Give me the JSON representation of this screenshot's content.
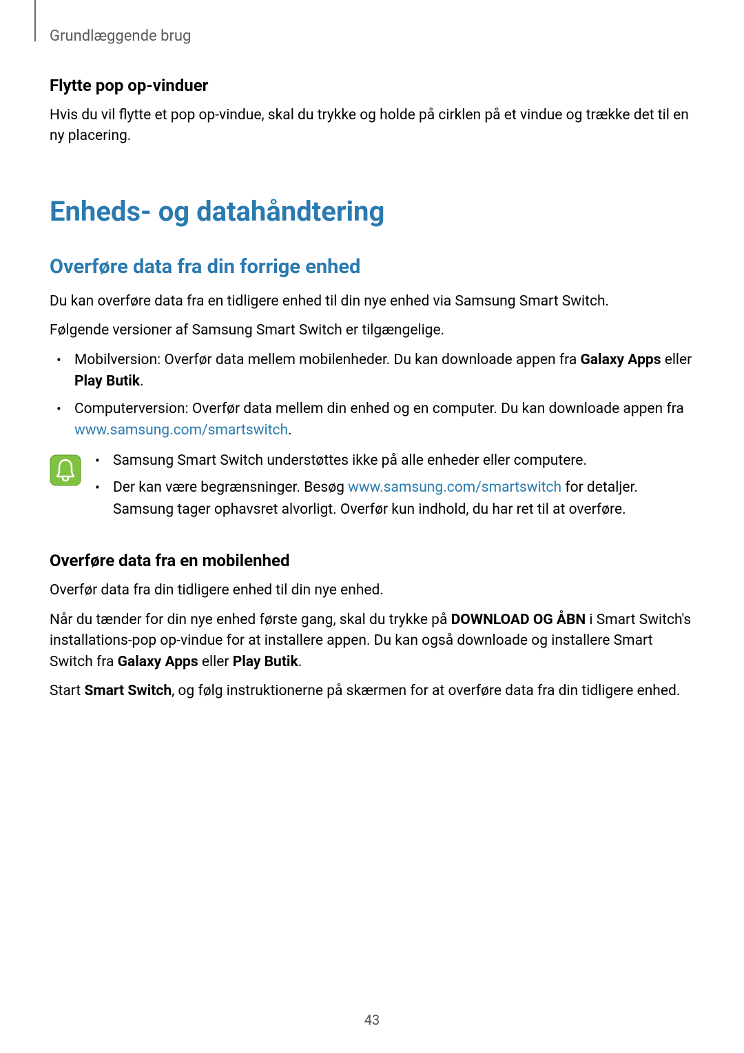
{
  "header": {
    "breadcrumb": "Grundlæggende brug"
  },
  "section1": {
    "title": "Flytte pop op-vinduer",
    "body": "Hvis du vil flytte et pop op-vindue, skal du trykke og holde på cirklen på et vindue og trække det til en ny placering."
  },
  "mainHeading": "Enheds- og datahåndtering",
  "section2": {
    "title": "Overføre data fra din forrige enhed",
    "body1": "Du kan overføre data fra en tidligere enhed til din nye enhed via Samsung Smart Switch.",
    "body2": "Følgende versioner af Samsung Smart Switch er tilgængelige.",
    "bullets": {
      "b1_pre": "Mobilversion: Overfør data mellem mobilenheder. Du kan downloade appen fra ",
      "b1_bold1": "Galaxy Apps",
      "b1_mid": " eller ",
      "b1_bold2": "Play Butik",
      "b1_end": ".",
      "b2_pre": "Computerversion: Overfør data mellem din enhed og en computer. Du kan downloade appen fra ",
      "b2_link": "www.samsung.com/smartswitch",
      "b2_end": "."
    },
    "note": {
      "n1": "Samsung Smart Switch understøttes ikke på alle enheder eller computere.",
      "n2_pre": "Der kan være begrænsninger. Besøg ",
      "n2_link": "www.samsung.com/smartswitch",
      "n2_post": " for detaljer. Samsung tager ophavsret alvorligt. Overfør kun indhold, du har ret til at overføre."
    }
  },
  "section3": {
    "title": "Overføre data fra en mobilenhed",
    "body1": "Overfør data fra din tidligere enhed til din nye enhed.",
    "p2_pre": "Når du tænder for din nye enhed første gang, skal du trykke på ",
    "p2_bold1": "DOWNLOAD OG ÅBN",
    "p2_mid1": " i Smart Switch's installations-pop op-vindue for at installere appen. Du kan også downloade og installere Smart Switch fra ",
    "p2_bold2": "Galaxy Apps",
    "p2_mid2": " eller ",
    "p2_bold3": "Play Butik",
    "p2_end": ".",
    "p3_pre": "Start ",
    "p3_bold": "Smart Switch",
    "p3_post": ", og følg instruktionerne på skærmen for at overføre data fra din tidligere enhed."
  },
  "pageNumber": "43"
}
